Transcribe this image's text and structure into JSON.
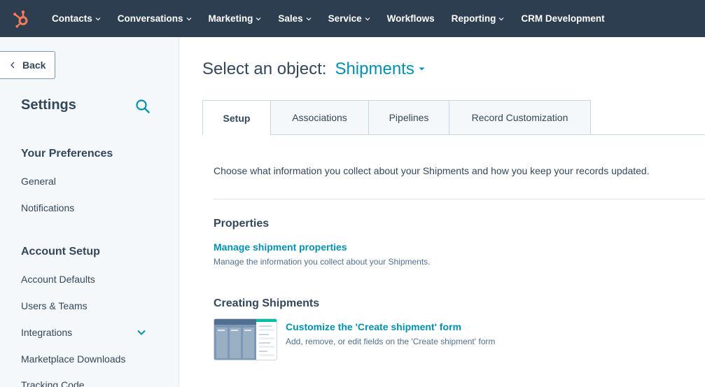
{
  "topnav": {
    "logo": "hubspot-sprocket-icon",
    "items": [
      {
        "label": "Contacts",
        "dropdown": true
      },
      {
        "label": "Conversations",
        "dropdown": true
      },
      {
        "label": "Marketing",
        "dropdown": true
      },
      {
        "label": "Sales",
        "dropdown": true
      },
      {
        "label": "Service",
        "dropdown": true
      },
      {
        "label": "Workflows",
        "dropdown": false
      },
      {
        "label": "Reporting",
        "dropdown": true
      },
      {
        "label": "CRM Development",
        "dropdown": false
      }
    ]
  },
  "sidebar": {
    "back_label": "Back",
    "title": "Settings",
    "sections": [
      {
        "heading": "Your Preferences",
        "items": [
          "General",
          "Notifications"
        ]
      },
      {
        "heading": "Account Setup",
        "items": [
          "Account Defaults",
          "Users & Teams",
          "Integrations",
          "Marketplace Downloads",
          "Tracking Code"
        ]
      }
    ]
  },
  "main": {
    "select_label": "Select an object:",
    "select_value": "Shipments",
    "tabs": [
      "Setup",
      "Associations",
      "Pipelines",
      "Record Customization"
    ],
    "active_tab": "Setup",
    "intro": "Choose what information you collect about your Shipments and how you keep your records updated.",
    "properties": {
      "heading": "Properties",
      "link": "Manage shipment properties",
      "desc": "Manage the information you collect about your Shipments."
    },
    "creating": {
      "heading": "Creating Shipments",
      "link": "Customize the 'Create shipment' form",
      "desc": "Add, remove, or edit fields on the 'Create shipment' form"
    }
  },
  "colors": {
    "nav_bg": "#2d3e50",
    "accent": "#0091ae",
    "logo": "#ff7a59",
    "sidebar_bg": "#f5f8fa",
    "text": "#33475b"
  }
}
